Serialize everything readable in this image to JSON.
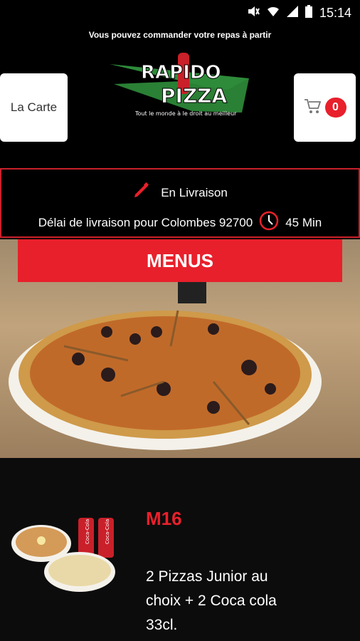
{
  "status_bar": {
    "time": "15:14",
    "icons": [
      "mute-icon",
      "wifi-icon",
      "signal-icon",
      "battery-icon"
    ]
  },
  "header": {
    "marquee_text": "Vous pouvez commander votre repas à partir",
    "carte_label": "La Carte",
    "cart_count": "0",
    "logo": {
      "line1": "RAPIDO",
      "line2": "PIZZA",
      "tagline": "Tout le monde à le droit au meilleur"
    }
  },
  "delivery": {
    "mode": "En Livraison",
    "delay_label": "Délai de livraison pour Colombes 92700",
    "delay_value": "45 Min"
  },
  "menus_banner": "MENUS",
  "product": {
    "code": "M16",
    "description": "2 Pizzas Junior au choix + 2 Coca cola 33cl."
  },
  "colors": {
    "accent": "#e8202b",
    "logo_green": "#2e8b3a"
  }
}
